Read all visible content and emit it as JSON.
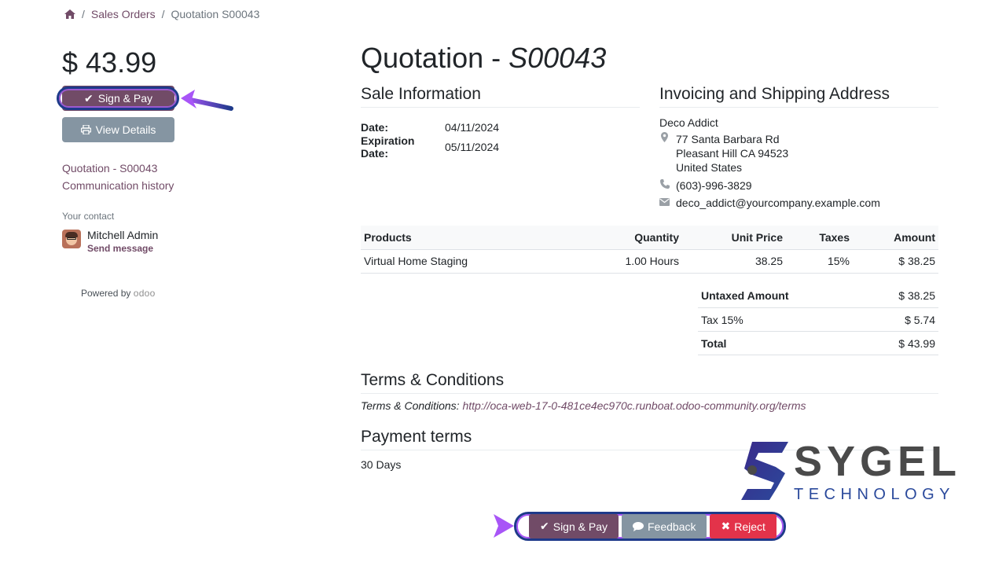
{
  "breadcrumb": {
    "home_icon": "home-icon",
    "sales_orders": "Sales Orders",
    "current": "Quotation S00043"
  },
  "summary": {
    "price": "$ 43.99",
    "sign_pay": "Sign & Pay",
    "view_details": "View Details",
    "link_quotation": "Quotation - S00043",
    "link_history": "Communication history",
    "contact_label": "Your contact",
    "contact_name": "Mitchell Admin",
    "send_message": "Send message",
    "powered_by": "Powered by",
    "powered_logo": "odoo"
  },
  "quotation": {
    "title_prefix": "Quotation - ",
    "title_number": "S00043"
  },
  "sale_info": {
    "heading": "Sale Information",
    "date_label": "Date:",
    "date_value": "04/11/2024",
    "expiration_label": "Expiration Date:",
    "expiration_value": "05/11/2024"
  },
  "address": {
    "heading": "Invoicing and Shipping Address",
    "name": "Deco Addict",
    "street": "77 Santa Barbara Rd",
    "city": "Pleasant Hill CA 94523",
    "country": "United States",
    "phone": "(603)-996-3829",
    "email": "deco_addict@yourcompany.example.com"
  },
  "products": {
    "headers": [
      "Products",
      "Quantity",
      "Unit Price",
      "Taxes",
      "Amount"
    ],
    "rows": [
      {
        "product": "Virtual Home Staging",
        "quantity": "1.00 Hours",
        "unit_price": "38.25",
        "taxes": "15%",
        "amount": "$ 38.25"
      }
    ]
  },
  "totals": {
    "untaxed_label": "Untaxed Amount",
    "untaxed_value": "$ 38.25",
    "tax_label": "Tax 15%",
    "tax_value": "$ 5.74",
    "total_label": "Total",
    "total_value": "$ 43.99"
  },
  "terms": {
    "heading": "Terms & Conditions",
    "label": "Terms & Conditions: ",
    "url": "http://oca-web-17-0-481ce4ec970c.runboat.odoo-community.org/terms"
  },
  "payment_terms": {
    "heading": "Payment terms",
    "value": "30 Days"
  },
  "bottom_bar": {
    "sign_pay": "Sign & Pay",
    "feedback": "Feedback",
    "reject": "Reject"
  },
  "watermark": {
    "word": "SYGEL",
    "sub": "TECHNOLOGY"
  },
  "colors": {
    "primary": "#714b67",
    "secondary": "#8595a2",
    "danger": "#e3334a",
    "highlight_blue": "#1e3a8a",
    "highlight_purple": "#a855f7"
  }
}
